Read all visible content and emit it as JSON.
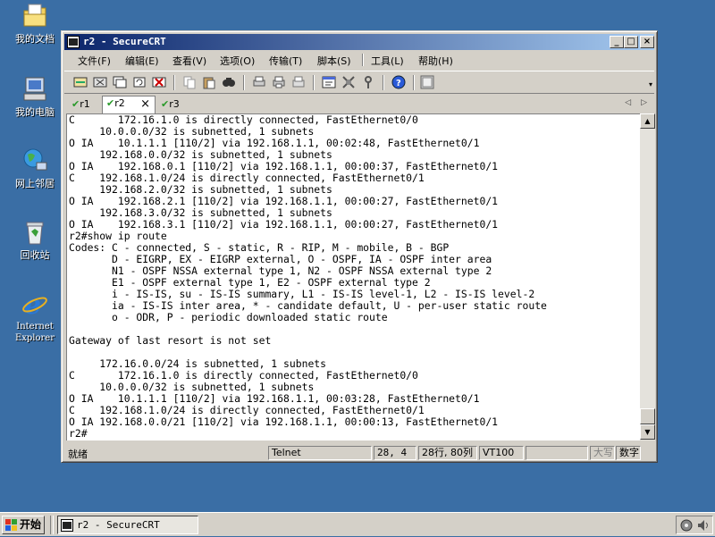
{
  "desktop": {
    "icons": [
      {
        "label": "我的文档",
        "icon": "my-documents-icon"
      },
      {
        "label": "我的电脑",
        "icon": "my-computer-icon"
      },
      {
        "label": "网上邻居",
        "icon": "network-places-icon"
      },
      {
        "label": "回收站",
        "icon": "recycle-bin-icon"
      },
      {
        "label": "Internet Explorer",
        "icon": "internet-explorer-icon"
      }
    ]
  },
  "window": {
    "title": "r2 - SecureCRT",
    "menu": [
      "文件(F)",
      "编辑(E)",
      "查看(V)",
      "选项(O)",
      "传输(T)",
      "脚本(S)",
      "工具(L)",
      "帮助(H)"
    ],
    "tabs": [
      {
        "label": "r1",
        "active": false
      },
      {
        "label": "r2",
        "active": true,
        "close": "×"
      },
      {
        "label": "r3",
        "active": false
      }
    ],
    "terminal_lines": [
      "C       172.16.1.0 is directly connected, FastEthernet0/0",
      "     10.0.0.0/32 is subnetted, 1 subnets",
      "O IA    10.1.1.1 [110/2] via 192.168.1.1, 00:02:48, FastEthernet0/1",
      "     192.168.0.0/32 is subnetted, 1 subnets",
      "O IA    192.168.0.1 [110/2] via 192.168.1.1, 00:00:37, FastEthernet0/1",
      "C    192.168.1.0/24 is directly connected, FastEthernet0/1",
      "     192.168.2.0/32 is subnetted, 1 subnets",
      "O IA    192.168.2.1 [110/2] via 192.168.1.1, 00:00:27, FastEthernet0/1",
      "     192.168.3.0/32 is subnetted, 1 subnets",
      "O IA    192.168.3.1 [110/2] via 192.168.1.1, 00:00:27, FastEthernet0/1",
      "r2#show ip route",
      "Codes: C - connected, S - static, R - RIP, M - mobile, B - BGP",
      "       D - EIGRP, EX - EIGRP external, O - OSPF, IA - OSPF inter area",
      "       N1 - OSPF NSSA external type 1, N2 - OSPF NSSA external type 2",
      "       E1 - OSPF external type 1, E2 - OSPF external type 2",
      "       i - IS-IS, su - IS-IS summary, L1 - IS-IS level-1, L2 - IS-IS level-2",
      "       ia - IS-IS inter area, * - candidate default, U - per-user static route",
      "       o - ODR, P - periodic downloaded static route",
      "",
      "Gateway of last resort is not set",
      "",
      "     172.16.0.0/24 is subnetted, 1 subnets",
      "C       172.16.1.0 is directly connected, FastEthernet0/0",
      "     10.0.0.0/32 is subnetted, 1 subnets",
      "O IA    10.1.1.1 [110/2] via 192.168.1.1, 00:03:28, FastEthernet0/1",
      "C    192.168.1.0/24 is directly connected, FastEthernet0/1",
      "O IA 192.168.0.0/21 [110/2] via 192.168.1.1, 00:00:13, FastEthernet0/1",
      "r2#"
    ],
    "status": {
      "ready": "就绪",
      "protocol": "Telnet",
      "cursor": "28,  4",
      "rows_cols": "28行, 80列",
      "emulation": "VT100",
      "caps": "大写",
      "num": "数字"
    }
  },
  "taskbar": {
    "start_label": "开始",
    "task_label": "r2 - SecureCRT"
  },
  "colors": {
    "desktop": "#3a6ea5",
    "titlebar_start": "#0a246a",
    "titlebar_end": "#a6caf0",
    "face": "#d4d0c8"
  }
}
